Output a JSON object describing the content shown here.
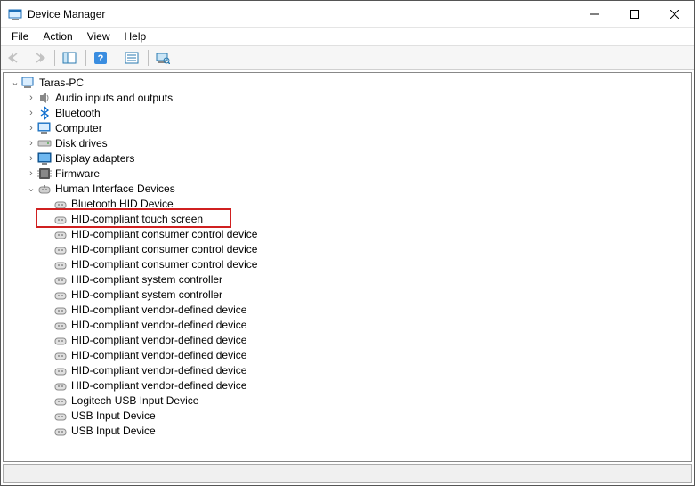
{
  "window": {
    "title": "Device Manager"
  },
  "menu": {
    "file": "File",
    "action": "Action",
    "view": "View",
    "help": "Help"
  },
  "tree": {
    "root": "Taras-PC",
    "categories": {
      "audio": "Audio inputs and outputs",
      "bluetooth": "Bluetooth",
      "computer": "Computer",
      "disk": "Disk drives",
      "display": "Display adapters",
      "firmware": "Firmware",
      "hid": "Human Interface Devices"
    },
    "hid_devices": [
      "Bluetooth HID Device",
      "HID-compliant touch screen",
      "HID-compliant consumer control device",
      "HID-compliant consumer control device",
      "HID-compliant consumer control device",
      "HID-compliant system controller",
      "HID-compliant system controller",
      "HID-compliant vendor-defined device",
      "HID-compliant vendor-defined device",
      "HID-compliant vendor-defined device",
      "HID-compliant vendor-defined device",
      "HID-compliant vendor-defined device",
      "HID-compliant vendor-defined device",
      "Logitech USB Input Device",
      "USB Input Device",
      "USB Input Device"
    ]
  },
  "highlighted_index": 1
}
